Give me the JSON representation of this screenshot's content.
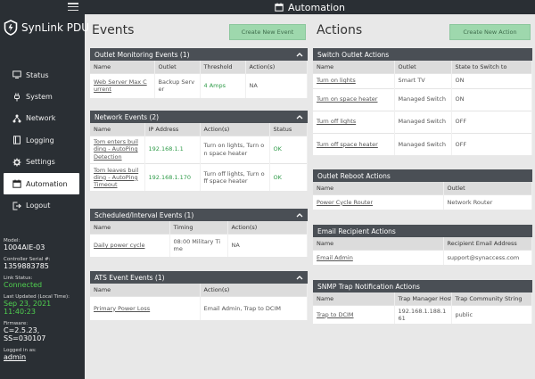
{
  "app": {
    "name": "SynLink PDU",
    "page_title": "Automation"
  },
  "nav": [
    {
      "label": "Status",
      "icon": "monitor-icon",
      "active": false
    },
    {
      "label": "System",
      "icon": "plug-icon",
      "active": false
    },
    {
      "label": "Network",
      "icon": "network-icon",
      "active": false
    },
    {
      "label": "Logging",
      "icon": "book-icon",
      "active": false
    },
    {
      "label": "Settings",
      "icon": "gear-icon",
      "active": false
    },
    {
      "label": "Automation",
      "icon": "calendar-icon",
      "active": true
    },
    {
      "label": "Logout",
      "icon": "logout-icon",
      "active": false
    }
  ],
  "info": {
    "model_label": "Model:",
    "model": "1004AIE-03",
    "serial_label": "Controller Serial #:",
    "serial": "1359883785",
    "link_label": "Link Status:",
    "link": "Connected",
    "updated_label": "Last Updated (Local Time):",
    "updated": "Sep 23, 2021 11:40:23",
    "firmware_label": "Firmware:",
    "firmware": "C=2.5.23, SS=030107",
    "logged_label": "Logged in as:",
    "logged": "admin"
  },
  "events": {
    "title": "Events",
    "create_label": "Create New Event",
    "outlet_monitoring": {
      "title": "Outlet Monitoring Events (1)",
      "headers": [
        "Name",
        "Outlet",
        "Threshold",
        "Action(s)"
      ],
      "rows": [
        [
          "Web Server Max Current",
          "Backup Server",
          "4 Amps",
          "NA"
        ]
      ]
    },
    "network": {
      "title": "Network Events (2)",
      "headers": [
        "Name",
        "IP Address",
        "Action(s)",
        "Status"
      ],
      "rows": [
        [
          "Tom enters building - AutoPing Detection",
          "192.168.1.1",
          "Turn on lights, Turn on space heater",
          "OK"
        ],
        [
          "Tom leaves building - AutoPing Timeout",
          "192.168.1.170",
          "Turn off lights, Turn off space heater",
          "OK"
        ]
      ]
    },
    "scheduled": {
      "title": "Scheduled/Interval Events (1)",
      "headers": [
        "Name",
        "Timing",
        "Action(s)"
      ],
      "rows": [
        [
          "Daily power cycle",
          "08:00 Military Time",
          "NA"
        ]
      ]
    },
    "ats": {
      "title": "ATS Event Events (1)",
      "headers": [
        "Name",
        "Action(s)"
      ],
      "rows": [
        [
          "Primary Power Loss",
          "Email Admin, Trap to DCIM"
        ]
      ]
    }
  },
  "actions": {
    "title": "Actions",
    "create_label": "Create New Action",
    "switch_outlet": {
      "title": "Switch Outlet Actions",
      "headers": [
        "Name",
        "Outlet",
        "State to Switch to"
      ],
      "rows": [
        [
          "Turn on lights",
          "Smart TV",
          "ON"
        ],
        [
          "Turn on space heater",
          "Managed Switch",
          "ON"
        ],
        [
          "Turn off lights",
          "Managed Switch",
          "OFF"
        ],
        [
          "Turn off space heater",
          "Managed Switch",
          "OFF"
        ]
      ]
    },
    "outlet_reboot": {
      "title": "Outlet Reboot Actions",
      "headers": [
        "Name",
        "Outlet"
      ],
      "rows": [
        [
          "Power Cycle Router",
          "Network Router"
        ]
      ]
    },
    "email": {
      "title": "Email Recipient Actions",
      "headers": [
        "Name",
        "Recipient Email Address"
      ],
      "rows": [
        [
          "Email Admin",
          "support@synaccess.com"
        ]
      ]
    },
    "snmp": {
      "title": "SNMP Trap Notification Actions",
      "headers": [
        "Name",
        "Trap Manager Host",
        "Trap Community String"
      ],
      "rows": [
        [
          "Trap to DCIM",
          "192.168.1.188.161",
          "public"
        ]
      ]
    }
  }
}
